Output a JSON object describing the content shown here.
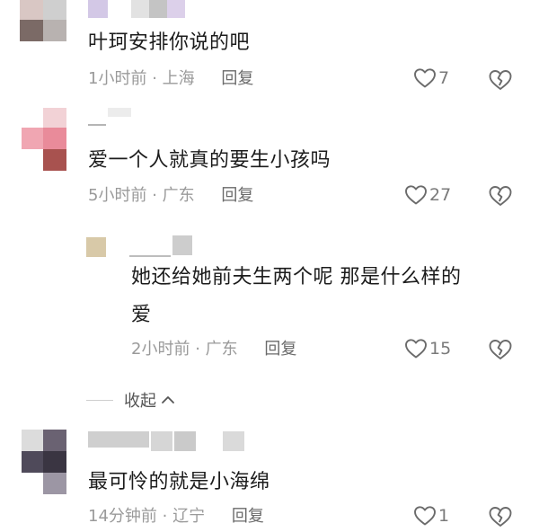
{
  "comments": [
    {
      "text": "叶珂安排你说的吧",
      "time": "1小时前",
      "sep": "·",
      "location": "上海",
      "reply": "回复",
      "likes": "7"
    },
    {
      "text": "爱一个人就真的要生小孩吗",
      "time": "5小时前",
      "sep": "·",
      "location": "广东",
      "reply": "回复",
      "likes": "27"
    },
    {
      "text_line1": "她还给她前夫生两个呢   那是什么样的",
      "text_line2": "爱",
      "time": "2小时前",
      "sep": "·",
      "location": "广东",
      "reply": "回复",
      "likes": "15"
    },
    {
      "text": "最可怜的就是小海绵",
      "time": "14分钟前",
      "sep": "·",
      "location": "辽宁",
      "reply": "回复",
      "likes": "1"
    }
  ],
  "collapse_label": "收起",
  "icons": {
    "like": "heart-outline-icon",
    "dislike": "broken-heart-icon",
    "collapse": "chevron-up-icon"
  },
  "colors": {
    "meta": "#9a9a9a",
    "reply": "#6a6a6a",
    "text": "#1c1c1c"
  }
}
